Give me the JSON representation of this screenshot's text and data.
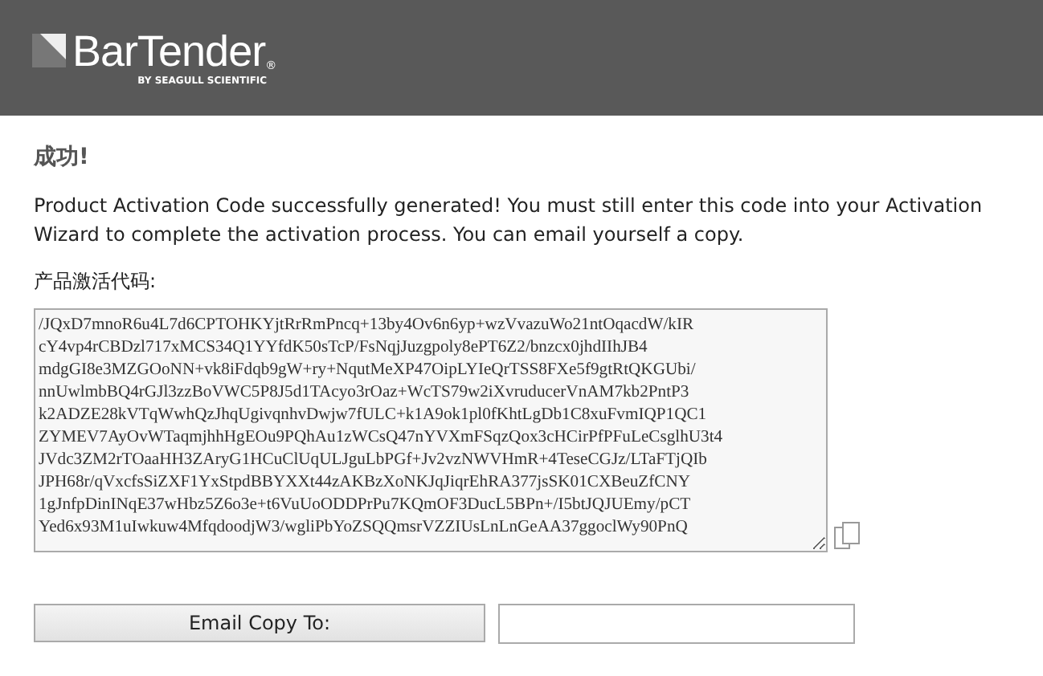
{
  "header": {
    "logo_text": "BarTender",
    "registered_mark": "®",
    "logo_tagline": "BY SEAGULL SCIENTIFIC"
  },
  "title": "成功!",
  "message": "Product Activation Code successfully generated! You must still enter this code into your Activation Wizard to complete the activation process. You can email yourself a copy.",
  "code_label": "产品激活代码:",
  "code_lines": [
    "/JQxD7mnoR6u4L7d6CPTOHKYjtRrRmPncq+13by4Ov6n6yp+wzVvazuWo21ntOqacdW/kIR",
    "cY4vp4rCBDzl717xMCS34Q1YYfdK50sTcP/FsNqjJuzgpoly8ePT6Z2/bnzcx0jhdIIhJB4",
    "mdgGI8e3MZGOoNN+vk8iFdqb9gW+ry+NqutMeXP47OipLYIeQrTSS8FXe5f9gtRtQKGUbi/",
    "nnUwlmbBQ4rGJl3zzBoVWC5P8J5d1TAcyo3rOaz+WcTS79w2iXvruducerVnAM7kb2PntP3",
    "k2ADZE28kVTqWwhQzJhqUgivqnhvDwjw7fULC+k1A9ok1pl0fKhtLgDb1C8xuFvmIQP1QC1",
    "ZYMEV7AyOvWTaqmjhhHgEOu9PQhAu1zWCsQ47nYVXmFSqzQox3cHCirPfPFuLeCsglhU3t4",
    "JVdc3ZM2rTOaaHH3ZAryG1HCuClUqULJguLbPGf+Jv2vzNWVHmR+4TeseCGJz/LTaFTjQIb",
    "JPH68r/qVxcfsSiZXF1YxStpdBBYXXt44zAKBzXoNKJqJiqrEhRA377jsSK01CXBeuZfCNY",
    "1gJnfpDinINqE37wHbz5Z6o3e+t6VuUoODDPrPu7KQmOF3DucL5BPn+/I5btJQJUEmy/pCT",
    "Yed6x93M1uIwkuw4MfqdoodjW3/wgliPbYoZSQQmsrVZZIUsLnLnGeAA37ggoclWy90PnQ"
  ],
  "email_button": "Email Copy To:"
}
